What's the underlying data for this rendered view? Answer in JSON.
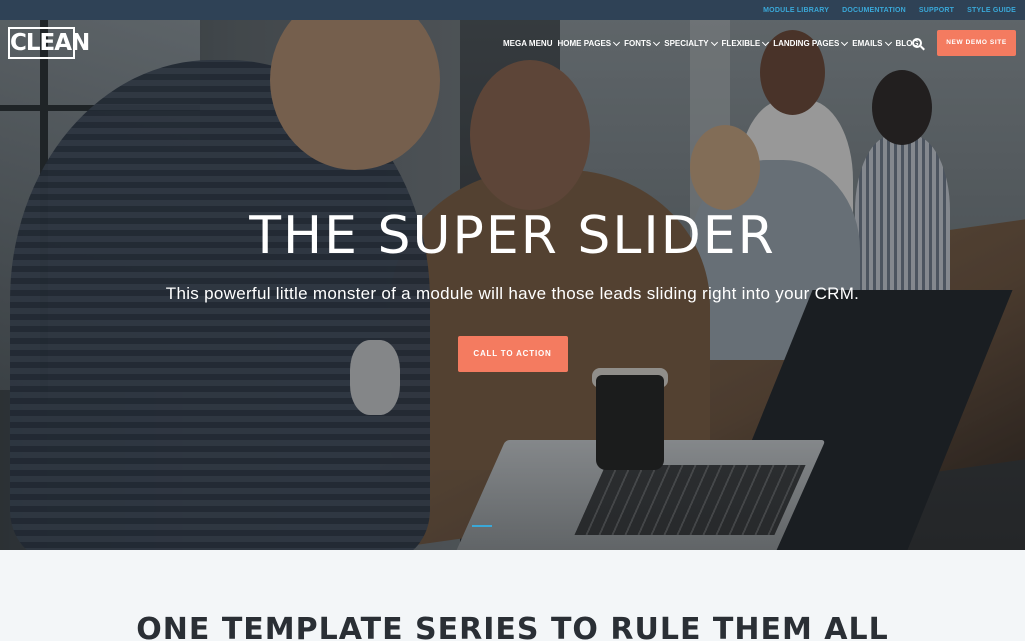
{
  "topbar": {
    "links": [
      "MODULE LIBRARY",
      "DOCUMENTATION",
      "SUPPORT",
      "STYLE GUIDE"
    ]
  },
  "header": {
    "logo": "CLEAN",
    "nav": [
      {
        "label": "MEGA MENU",
        "dropdown": false
      },
      {
        "label": "HOME PAGES",
        "dropdown": true
      },
      {
        "label": "FONTS",
        "dropdown": true
      },
      {
        "label": "SPECIALTY",
        "dropdown": true
      },
      {
        "label": "FLEXIBLE",
        "dropdown": true
      },
      {
        "label": "LANDING PAGES",
        "dropdown": true
      },
      {
        "label": "EMAILS",
        "dropdown": true
      },
      {
        "label": "BLOG",
        "dropdown": false
      }
    ],
    "demo_button": "NEW DEMO SITE"
  },
  "hero": {
    "title": "THE SUPER SLIDER",
    "subtitle": "This powerful little monster of a module will have those leads sliding right into your CRM.",
    "cta": "CALL TO ACTION"
  },
  "section": {
    "title": "ONE TEMPLATE SERIES TO RULE THEM ALL"
  },
  "colors": {
    "topbar_bg": "#2f4256",
    "accent": "#f47b60",
    "link": "#3aa8d8",
    "section_bg": "#f3f6f8"
  }
}
